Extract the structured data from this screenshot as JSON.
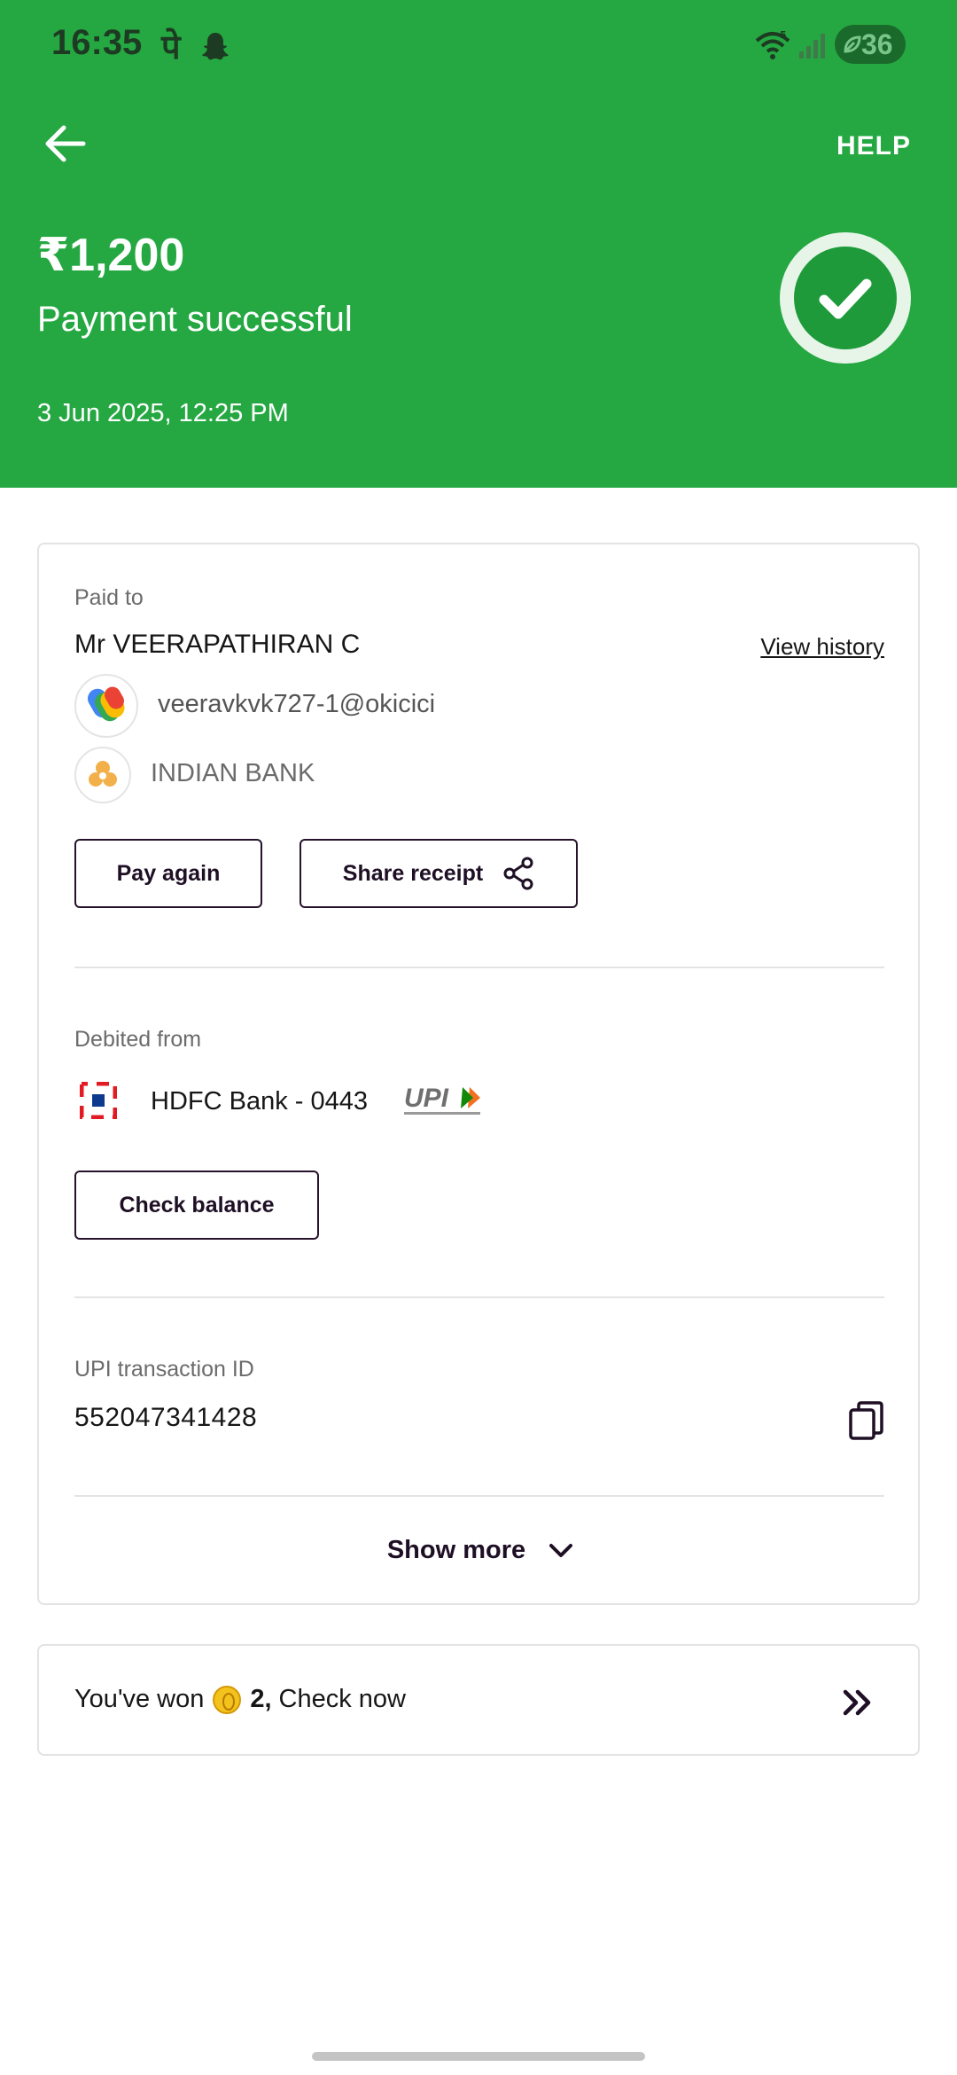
{
  "status_bar": {
    "time": "16:35",
    "app_indicator": "पे",
    "battery": "36",
    "icons": [
      "snapchat-icon",
      "wifi-icon",
      "signal-icon",
      "battery-saver-icon"
    ]
  },
  "header": {
    "help_label": "HELP",
    "amount": "₹1,200",
    "status": "Payment successful",
    "datetime": "3 Jun 2025, 12:25 PM",
    "accent_color": "#25a842"
  },
  "paid_to": {
    "label": "Paid to",
    "name": "Mr VEERAPATHIRAN C",
    "view_history": "View history",
    "upi_id": "veeravkvk727-1@okicici",
    "bank": "INDIAN BANK",
    "pay_again": "Pay again",
    "share_receipt": "Share receipt"
  },
  "debited_from": {
    "label": "Debited from",
    "account": "HDFC Bank - 0443",
    "check_balance": "Check balance"
  },
  "transaction": {
    "label": "UPI transaction ID",
    "id": "552047341428",
    "show_more": "Show more"
  },
  "reward": {
    "prefix": "You've won",
    "amount": "2,",
    "suffix": "Check now"
  }
}
